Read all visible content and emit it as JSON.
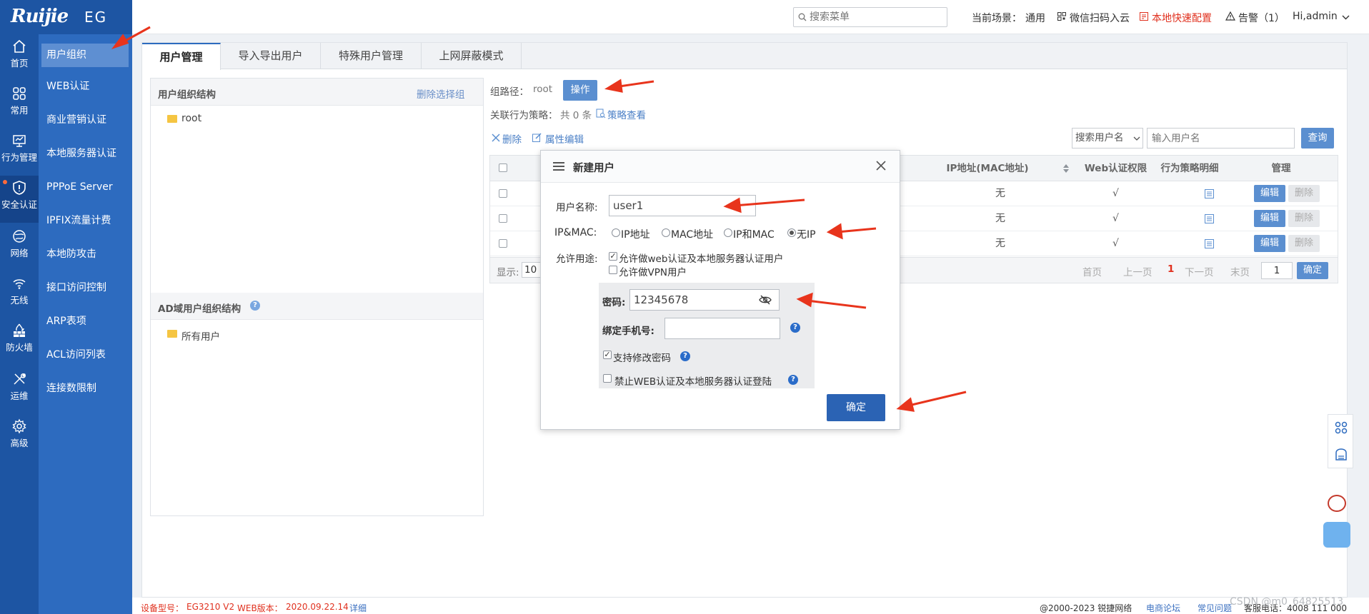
{
  "brand": {
    "logo": "Ruijie",
    "model": "EG"
  },
  "rail": [
    {
      "label": "首页",
      "icon": "home-icon"
    },
    {
      "label": "常用",
      "icon": "grid-icon"
    },
    {
      "label": "行为管理",
      "icon": "monitor-icon"
    },
    {
      "label": "安全认证",
      "icon": "shield-icon"
    },
    {
      "label": "网络",
      "icon": "globe-icon"
    },
    {
      "label": "无线",
      "icon": "wifi-icon"
    },
    {
      "label": "防火墙",
      "icon": "firewall-icon"
    },
    {
      "label": "运维",
      "icon": "tools-icon"
    },
    {
      "label": "高级",
      "icon": "gear-icon"
    }
  ],
  "submenu": [
    "用户组织",
    "WEB认证",
    "商业营销认证",
    "本地服务器认证",
    "PPPoE Server",
    "IPFIX流量计费",
    "本地防攻击",
    "接口访问控制",
    "ARP表项",
    "ACL访问列表",
    "连接数限制"
  ],
  "topbar": {
    "search_placeholder": "搜索菜单",
    "scene_label": "当前场景：",
    "scene_value": "通用",
    "wechat": "微信扫码入云",
    "quick_config": "本地快速配置",
    "alarm": "告警（1）",
    "user": "Hi,admin"
  },
  "tabs": [
    "用户管理",
    "导入导出用户",
    "特殊用户管理",
    "上网屏蔽模式"
  ],
  "tree": {
    "title": "用户组织结构",
    "delete_link": "删除选择组",
    "root": "root",
    "ad_title": "AD域用户组织结构",
    "ad_root": "所有用户"
  },
  "group": {
    "path_label": "组路径：",
    "path_value": "root",
    "op_button": "操作",
    "policy_label": "关联行为策略：",
    "policy_count": "共 0 条",
    "policy_link": "策略查看",
    "delete": "删除",
    "edit_attr": "属性编辑",
    "search_select": "搜索用户名",
    "search_placeholder": "输入用户名",
    "query": "查询"
  },
  "grid": {
    "headers": [
      "IP地址(MAC地址)",
      "Web认证权限",
      "行为策略明细",
      "管理"
    ],
    "rows": [
      {
        "ip": "无",
        "web": "√",
        "edit": "编辑",
        "del": "删除"
      },
      {
        "ip": "无",
        "web": "√",
        "edit": "编辑",
        "del": "删除"
      },
      {
        "ip": "无",
        "web": "√",
        "edit": "编辑",
        "del": "删除"
      }
    ],
    "show_label": "显示:",
    "page_size": "10",
    "first": "首页",
    "prev": "上一页",
    "current_page": "1",
    "next": "下一页",
    "last": "末页",
    "goto_value": "1",
    "confirm": "确定"
  },
  "dialog": {
    "title": "新建用户",
    "username_label": "用户名称:",
    "username_value": "user1",
    "ipmac_label": "IP&MAC:",
    "opt_ip": "IP地址",
    "opt_mac": "MAC地址",
    "opt_ipmac": "IP和MAC",
    "opt_none": "无IP",
    "usage_label": "允许用途:",
    "usage_web": "允许做web认证及本地服务器认证用户",
    "usage_vpn": "允许做VPN用户",
    "pwd_label": "密码:",
    "pwd_value": "12345678",
    "phone_label": "绑定手机号:",
    "allow_change_pwd": "支持修改密码",
    "forbid_login": "禁止WEB认证及本地服务器认证登陆",
    "ok": "确定"
  },
  "footer": {
    "device_label": "设备型号：",
    "device": "EG3210 V2",
    "version_label": "WEB版本：",
    "version": "2020.09.22.14",
    "detail": "详细",
    "copyright": "@2000-2023 锐捷网络",
    "forum": "电商论坛",
    "faq": "常见问题",
    "hotline": "客服电话：4008 111 000",
    "watermark": "CSDN @m0_64825513"
  },
  "colors": {
    "rail": "#1d55a3",
    "submenu": "#2d6bbf",
    "accent": "#5b8fd0",
    "arrow": "#e8341c"
  }
}
